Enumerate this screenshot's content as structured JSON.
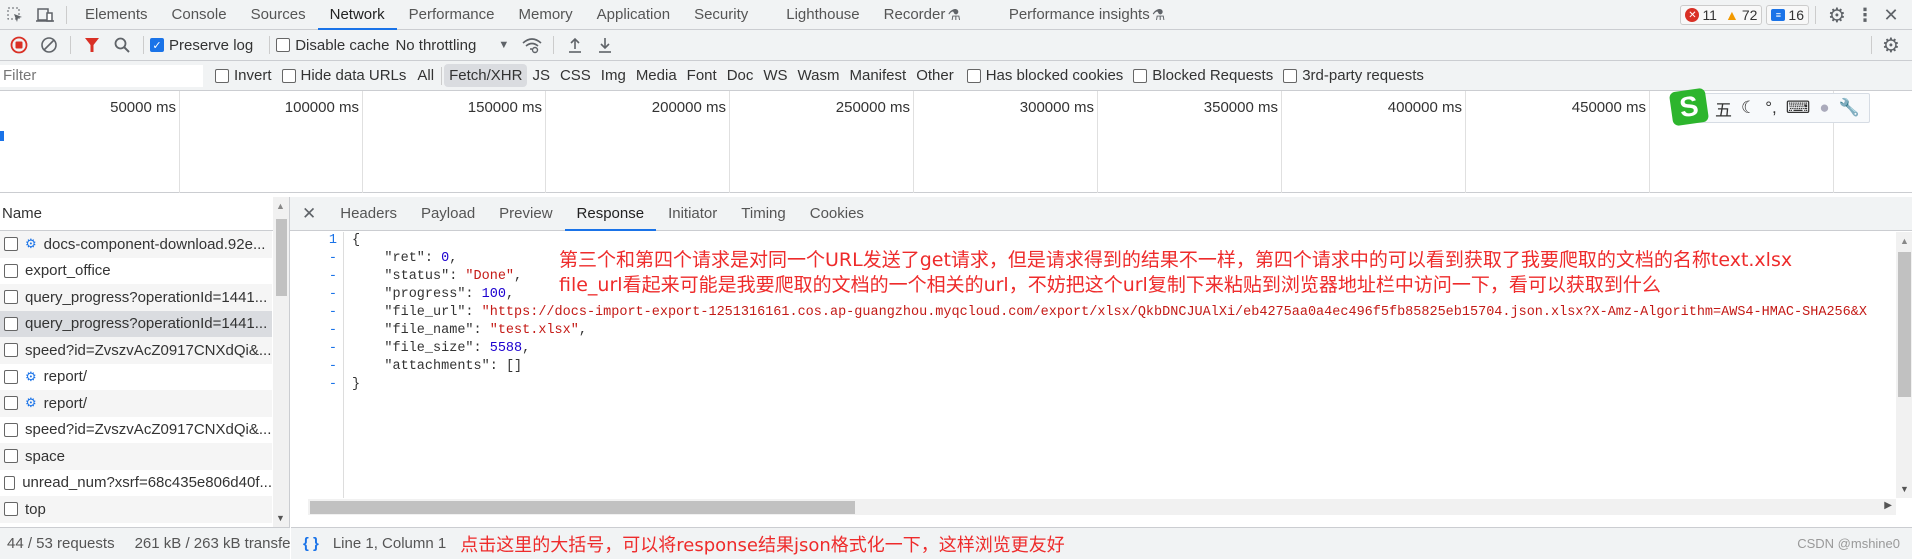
{
  "tabbar": {
    "tabs": [
      "Elements",
      "Console",
      "Sources",
      "Network",
      "Performance",
      "Memory",
      "Application",
      "Security",
      "Lighthouse",
      "Recorder",
      "Performance insights"
    ],
    "active": "Network",
    "experimental_tabs": [
      "Recorder",
      "Performance insights"
    ],
    "errors": "11",
    "warnings": "72",
    "messages": "16"
  },
  "toolbar": {
    "preserve_log": "Preserve log",
    "preserve_log_checked": true,
    "disable_cache": "Disable cache",
    "disable_cache_checked": false,
    "throttling": "No throttling"
  },
  "filterbar": {
    "filter_placeholder": "Filter",
    "invert": "Invert",
    "hide_data_urls": "Hide data URLs",
    "types": [
      "All",
      "Fetch/XHR",
      "JS",
      "CSS",
      "Img",
      "Media",
      "Font",
      "Doc",
      "WS",
      "Wasm",
      "Manifest",
      "Other"
    ],
    "active_type": "Fetch/XHR",
    "has_blocked_cookies": "Has blocked cookies",
    "blocked_requests": "Blocked Requests",
    "third_party": "3rd-party requests"
  },
  "overview": {
    "ticks": [
      "50000 ms",
      "100000 ms",
      "150000 ms",
      "200000 ms",
      "250000 ms",
      "300000 ms",
      "350000 ms",
      "400000 ms",
      "450000 ms"
    ]
  },
  "ime_toolbar": {
    "logo": "S",
    "mode": "五"
  },
  "requests": {
    "header": "Name",
    "items": [
      {
        "name": "docs-component-download.92e...",
        "gear": true
      },
      {
        "name": "export_office",
        "gear": false
      },
      {
        "name": "query_progress?operationId=1441...",
        "gear": false
      },
      {
        "name": "query_progress?operationId=1441...",
        "gear": false,
        "selected": true
      },
      {
        "name": "speed?id=ZvszvAcZ0917CNXdQi&...",
        "gear": false
      },
      {
        "name": "report/",
        "gear": true
      },
      {
        "name": "report/",
        "gear": true
      },
      {
        "name": "speed?id=ZvszvAcZ0917CNXdQi&...",
        "gear": false
      },
      {
        "name": "space",
        "gear": false
      },
      {
        "name": "unread_num?xsrf=68c435e806d40f...",
        "gear": false
      },
      {
        "name": "top",
        "gear": false
      }
    ]
  },
  "detail": {
    "tabs": [
      "Headers",
      "Payload",
      "Preview",
      "Response",
      "Initiator",
      "Timing",
      "Cookies"
    ],
    "active": "Response",
    "gutter": [
      "1",
      "-",
      "-",
      "-",
      "-",
      "-",
      "-",
      "-",
      "-"
    ],
    "response": {
      "ret": "0",
      "status": "\"Done\"",
      "progress": "100",
      "file_url": "\"https://docs-import-export-1251316161.cos.ap-guangzhou.myqcloud.com/export/xlsx/QkbDNCJUAlXi/eb4275aa0a4ec496f5fb85825eb15704.json.xlsx?X-Amz-Algorithm=AWS4-HMAC-SHA256&X",
      "file_name": "\"test.xlsx\"",
      "file_size": "5588",
      "attachments": "[]"
    },
    "annotation_line1": "第三个和第四个请求是对同一个URL发送了get请求，但是请求得到的结果不一样，第四个请求中的可以看到获取了我要爬取的文档的名称text.xlsx",
    "annotation_line2": "file_url看起来可能是我要爬取的文档的一个相关的url，不妨把这个url复制下来粘贴到浏览器地址栏中访问一下，看可以获取到什么"
  },
  "status": {
    "requests": "44 / 53 requests",
    "transferred": "261 kB / 263 kB transfe",
    "pretty_print": "{ }",
    "cursor": "Line 1, Column 1",
    "annotation": "点击这里的大括号，可以将response结果json格式化一下，这样浏览更友好",
    "watermark": "CSDN @mshine0"
  }
}
